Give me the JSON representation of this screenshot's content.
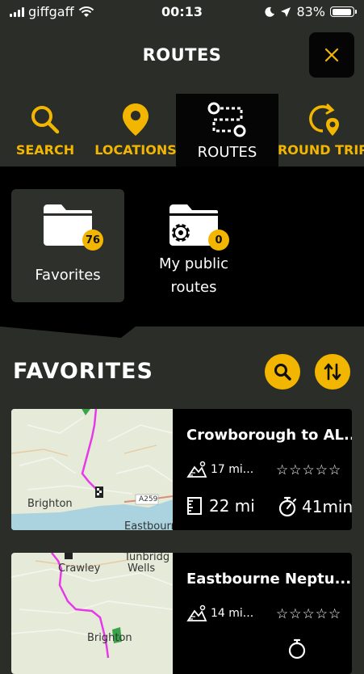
{
  "status": {
    "carrier": "giffgaff",
    "time": "00:13",
    "battery": "83%"
  },
  "header": {
    "title": "ROUTES"
  },
  "tabs": [
    {
      "label": "SEARCH",
      "icon": "search-icon"
    },
    {
      "label": "LOCATIONS",
      "icon": "location-pin-icon"
    },
    {
      "label": "ROUTES",
      "icon": "routes-icon",
      "active": true
    },
    {
      "label": "ROUND TRIP",
      "icon": "round-trip-icon"
    }
  ],
  "folders": [
    {
      "label": "Favorites",
      "count": "76"
    },
    {
      "label_line1": "My public",
      "label_line2": "routes",
      "count": "0"
    }
  ],
  "section": {
    "title": "FAVORITES"
  },
  "routes": [
    {
      "name": "Crowborough to AL...",
      "distance": "17 mi...",
      "total": "22 mi",
      "duration": "41min",
      "map_labels": [
        "Brighton",
        "Eastbourn",
        "A259"
      ]
    },
    {
      "name": "Eastbourne Neptu...",
      "distance": "14 mi...",
      "map_labels": [
        "Crawley",
        "Tunbridg",
        "Wells",
        "Brighton"
      ]
    }
  ],
  "colors": {
    "accent": "#f2b600",
    "background": "#2a2d28",
    "panel": "#000000"
  }
}
